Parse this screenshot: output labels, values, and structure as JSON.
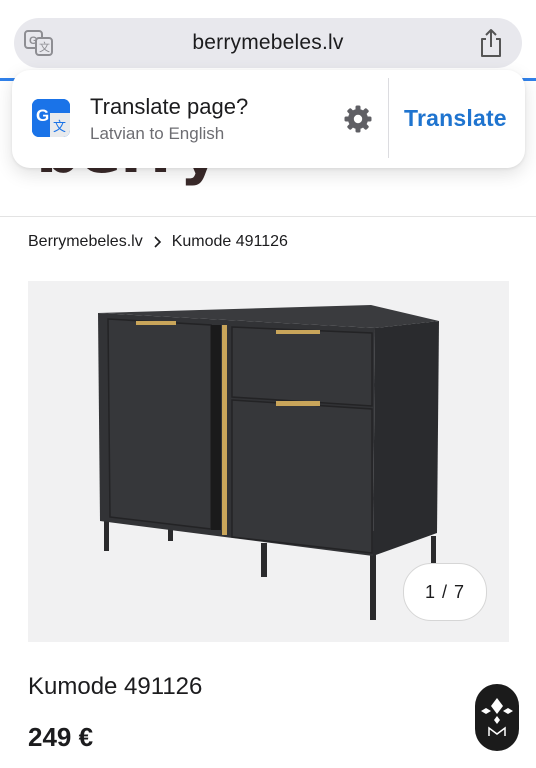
{
  "browser": {
    "url": "berrymebeles.lv",
    "translate_icon": "translate-icon",
    "share_icon": "share-icon"
  },
  "site": {
    "logo_text": "berry"
  },
  "translate_popup": {
    "title": "Translate page?",
    "subtitle": "Latvian to English",
    "settings_icon": "gear-icon",
    "action_label": "Translate"
  },
  "breadcrumb": {
    "items": [
      "Berrymebeles.lv",
      "Kumode 491126"
    ],
    "separator_icon": "chevron-right-icon"
  },
  "product": {
    "image_counter": "1 / 7",
    "title": "Kumode 491126",
    "price": "249 €"
  },
  "colors": {
    "accent": "#1f74cf",
    "url_bar_bg": "#e8e8ed",
    "image_bg": "#f1f1f2",
    "cabinet": "#2f3033",
    "handle_gold": "#c9a55a"
  }
}
